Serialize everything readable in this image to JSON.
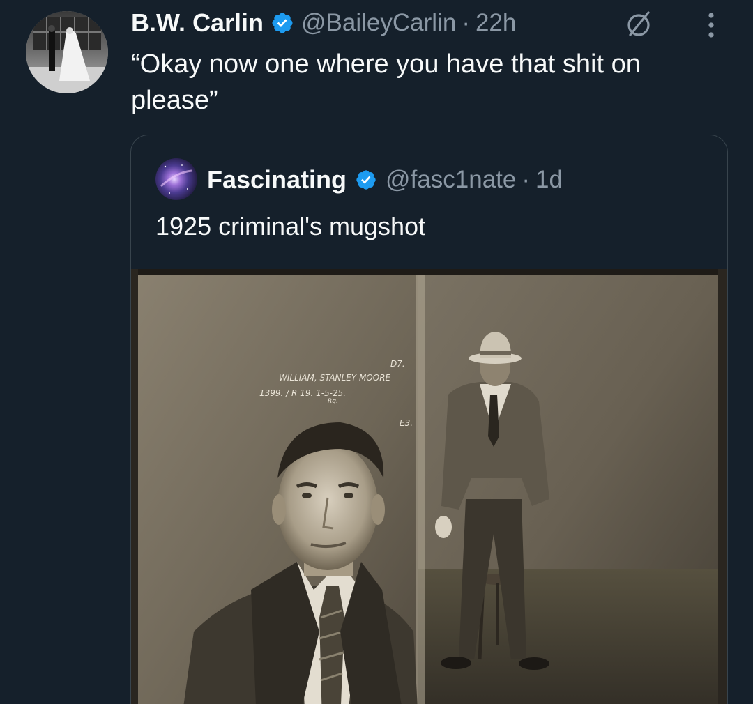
{
  "author": {
    "display_name": "B.W. Carlin",
    "handle": "@BaileyCarlin",
    "separator": "·",
    "time": "22h",
    "avatar_icon": "wedding-photo-avatar",
    "verified_icon": "verified-badge-icon"
  },
  "tweet": {
    "text": "“Okay now one where you have that shit on please”"
  },
  "actions": {
    "edit_icon": "edit-history-icon",
    "more_icon": "more-options-icon"
  },
  "quoted": {
    "display_name": "Fascinating",
    "handle": "@fasc1nate",
    "separator": "·",
    "time": "1d",
    "text": "1925 criminal's mugshot",
    "avatar_icon": "galaxy-avatar",
    "verified_icon": "verified-badge-icon",
    "media": {
      "type": "sepia-mugshot-photo",
      "caption_lines": [
        "D7.",
        "WILLIAM, STANLEY MOORE",
        "1399. / R 19. 1-5-25.",
        "Rq.",
        "E3."
      ]
    }
  },
  "colors": {
    "background": "#15202b",
    "text_primary": "#f7f9f9",
    "text_secondary": "#8b98a5",
    "verified_blue": "#1d9bf0",
    "border": "#38444d"
  }
}
